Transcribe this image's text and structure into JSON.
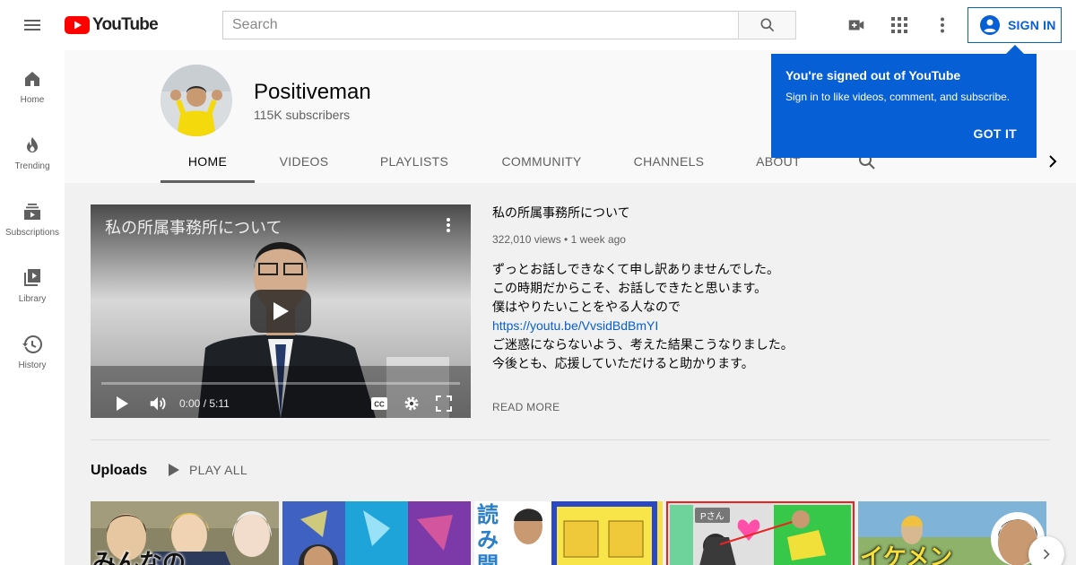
{
  "brand": {
    "logo_text": "YouTube",
    "logo_color": "#ff0000"
  },
  "header": {
    "search_placeholder": "Search",
    "signin_label": "SIGN IN",
    "accent": "#065fd4"
  },
  "sidebar": {
    "items": [
      {
        "label": "Home",
        "icon": "home-icon"
      },
      {
        "label": "Trending",
        "icon": "fire-icon"
      },
      {
        "label": "Subscriptions",
        "icon": "subscriptions-icon"
      },
      {
        "label": "Library",
        "icon": "library-icon"
      },
      {
        "label": "History",
        "icon": "history-icon"
      }
    ]
  },
  "channel": {
    "name": "Positiveman",
    "subscribers": "115K subscribers",
    "tabs": [
      "HOME",
      "VIDEOS",
      "PLAYLISTS",
      "COMMUNITY",
      "CHANNELS",
      "ABOUT"
    ],
    "active_tab": "HOME"
  },
  "tooltip": {
    "title": "You're signed out of YouTube",
    "body": "Sign in to like videos, comment, and subscribe.",
    "button": "GOT IT"
  },
  "featured": {
    "overlay_title": "私の所属事務所について",
    "title": "私の所属事務所について",
    "meta": "322,010 views • 1 week ago",
    "time": "0:00 / 5:11",
    "progress": 0.0,
    "description": [
      "ずっとお話しできなくて申し訳ありませんでした。",
      "この時期だからこそ、お話しできたと思います。",
      "僕はやりたいことをやる人なので"
    ],
    "link": "https://youtu.be/VvsidBdBmYI",
    "description_after": [
      "ご迷惑にならないよう、考えた結果こうなりました。",
      "今後とも、応援していただけると助かります。"
    ],
    "read_more": "READ MORE"
  },
  "uploads": {
    "title": "Uploads",
    "play_all": "PLAY ALL",
    "thumbnails": [
      {
        "text": "みんなの"
      },
      {
        "text": ""
      },
      {
        "text": "読み聞"
      },
      {
        "text": "Pさん"
      },
      {
        "text": "イケメン"
      }
    ]
  }
}
